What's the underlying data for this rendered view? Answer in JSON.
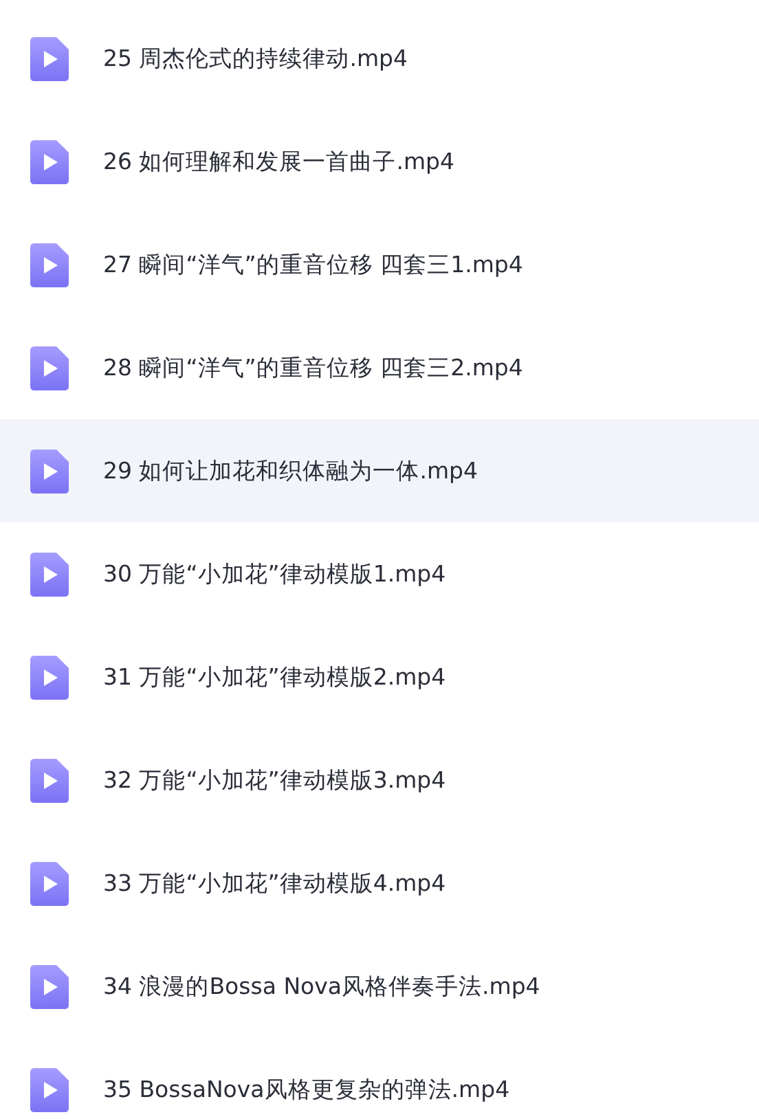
{
  "files": [
    {
      "name": "25 周杰伦式的持续律动.mp4",
      "selected": false
    },
    {
      "name": "26 如何理解和发展一首曲子.mp4",
      "selected": false
    },
    {
      "name": "27 瞬间“洋气”的重音位移 四套三1.mp4",
      "selected": false
    },
    {
      "name": "28 瞬间“洋气”的重音位移 四套三2.mp4",
      "selected": false
    },
    {
      "name": "29 如何让加花和织体融为一体.mp4",
      "selected": true
    },
    {
      "name": "30 万能“小加花”律动模版1.mp4",
      "selected": false
    },
    {
      "name": "31 万能“小加花”律动模版2.mp4",
      "selected": false
    },
    {
      "name": "32 万能“小加花”律动模版3.mp4",
      "selected": false
    },
    {
      "name": "33 万能“小加花”律动模版4.mp4",
      "selected": false
    },
    {
      "name": "34 浪漫的Bossa Nova风格伴奏手法.mp4",
      "selected": false
    },
    {
      "name": "35 BossaNova风格更复杂的弹法.mp4",
      "selected": false
    }
  ]
}
